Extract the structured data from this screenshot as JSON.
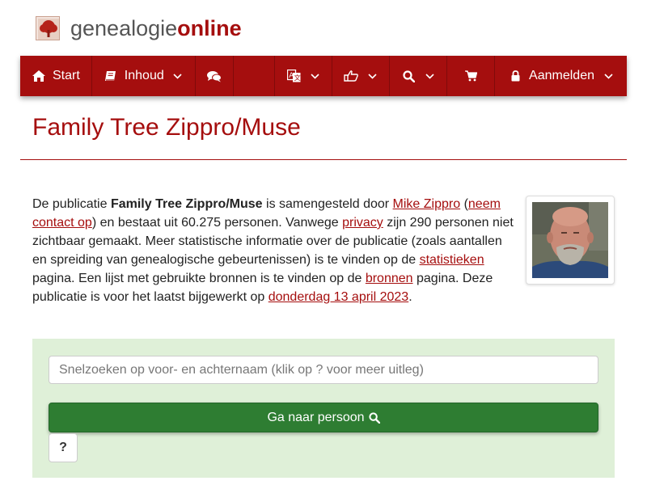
{
  "site": {
    "logo_part1": "genealogie",
    "logo_part2": "online",
    "logo_icon": "tree-icon",
    "brand_color": "#a50e0e"
  },
  "nav": {
    "start_label": "Start",
    "start_icon": "home-icon",
    "content_label": "Inhoud",
    "content_icon": "book-icon",
    "chat_icon": "comments-icon",
    "language_icon": "language-icon",
    "share_icon": "share-icon",
    "search_icon": "search-icon",
    "cart_icon": "shopping-cart-icon",
    "login_label": "Aanmelden",
    "login_icon": "lock-icon"
  },
  "page": {
    "title": "Family Tree Zippro/Muse"
  },
  "description": {
    "t1": "De publicatie ",
    "pub_name": "Family Tree Zippro/Muse",
    "t2": " is samengesteld door ",
    "author_link": "Mike Zippro",
    "t3": " (",
    "contact_link": "neem contact op",
    "t4": ") en bestaat uit 60.275 personen. Vanwege ",
    "privacy_link": "privacy",
    "t5": " zijn 290 personen niet zichtbaar gemaakt. Meer statistische informatie over de publicatie (zoals aantallen en spreiding van genealogische gebeurtenissen) is te vinden op de ",
    "stats_link": "statistieken",
    "t6": " pagina. Een lijst met gebruikte bronnen is te vinden op de ",
    "sources_link": "bronnen",
    "t7": " pagina. Deze publicatie is voor het laatst bijgewerkt op ",
    "date_link": "donderdag 13 april 2023",
    "t8": "."
  },
  "search": {
    "placeholder": "Snelzoeken op voor- en achternaam (klik op ? voor meer uitleg)",
    "go_label": "Ga naar persoon",
    "help_label": "?",
    "panel_color": "#dff0d8",
    "button_color": "#2e7d32"
  }
}
